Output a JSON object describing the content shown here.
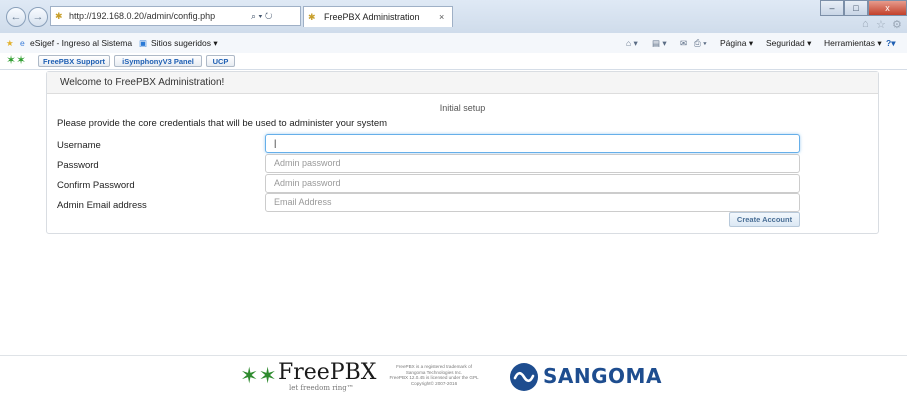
{
  "browser": {
    "address": "http://192.168.0.20/admin/config.php",
    "address_tools": "⌕ ▾ ↻",
    "tab_title": "FreePBX Administration",
    "tab_close": "×",
    "window_min": "–",
    "window_max": "□",
    "window_close": "x",
    "back": "←",
    "forward": "→",
    "favorites": [
      "eSigef - Ingreso al Sistema",
      "Sitios sugeridos ▾"
    ],
    "toolbar": {
      "page": "Página ▾",
      "security": "Seguridad ▾",
      "tools": "Herramientas ▾",
      "help": "?▾"
    },
    "links": [
      "FreePBX Support",
      "iSymphonyV3 Panel",
      "UCP"
    ]
  },
  "panel": {
    "header": "Welcome to FreePBX Administration!",
    "title": "Initial setup",
    "intro": "Please provide the core credentials that will be used to administer your system",
    "fields": [
      {
        "label": "Username",
        "value": "|",
        "placeholder": ""
      },
      {
        "label": "Password",
        "value": "",
        "placeholder": "Admin password"
      },
      {
        "label": "Confirm Password",
        "value": "",
        "placeholder": "Admin password"
      },
      {
        "label": "Admin Email address",
        "value": "",
        "placeholder": "Email Address"
      }
    ],
    "submit": "Create Account"
  },
  "footer": {
    "freepbx_name": "FreePBX",
    "freepbx_tagline": "let freedom ring™",
    "legal": [
      "FreePBX is a registered trademark of",
      "Sangoma Technologies Inc.",
      "FreePBX 12.0.45 is licensed under the GPL",
      "Copyright© 2007-2016"
    ],
    "sangoma": "SANGOMA"
  },
  "colors": {
    "accent": "#1e5fb3",
    "sangoma_blue": "#1e4d8f",
    "freepbx_green": "#2e8b2e",
    "focus_border": "#66afe9"
  },
  "icons": [
    "back-icon",
    "forward-icon",
    "favicon-icon",
    "favorites-star-icon",
    "home-icon",
    "freepbx-frog-icon",
    "sangoma-wave-icon"
  ]
}
